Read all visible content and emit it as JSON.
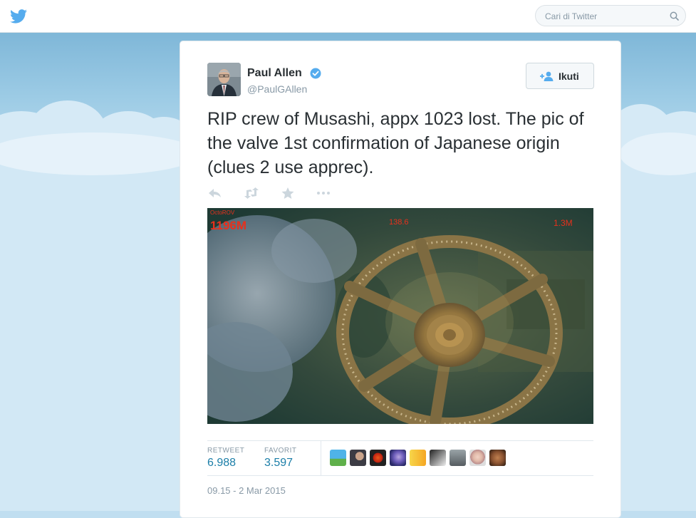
{
  "header": {
    "search_placeholder": "Cari di Twitter"
  },
  "tweet": {
    "author_name": "Paul Allen",
    "author_handle": "@PaulGAllen",
    "follow_label": "Ikuti",
    "text": "RIP crew of Musashi, appx 1023 lost. The pic of the valve 1st confirmation of Japanese origin (clues 2 use apprec).",
    "media_overlay": {
      "label": "OctoROV",
      "depth": "1196M",
      "heading": "138.6",
      "range": "1.3M"
    },
    "stats": {
      "retweet_label": "RETWEET",
      "retweet_count": "6.988",
      "favorite_label": "FAVORIT",
      "favorite_count": "3.597"
    },
    "favoriters": [
      "avatar-1",
      "avatar-2",
      "avatar-3",
      "avatar-4",
      "avatar-5",
      "avatar-6",
      "avatar-7",
      "avatar-8",
      "avatar-9"
    ],
    "timestamp": "09.15 - 2 Mar 2015"
  },
  "colors": {
    "brand": "#55acee",
    "link": "#1b7ea8",
    "overlay_red": "#e8301c"
  }
}
